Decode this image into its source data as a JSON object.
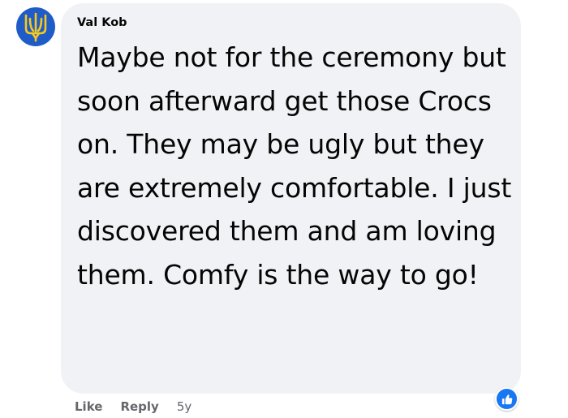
{
  "comment": {
    "author": "Val Kob",
    "text": "Maybe not for the ceremony but soon afterward get those Crocs on. They may be ugly but they are extremely comfortable. I just discovered them and am loving them. Comfy is the way to go!",
    "avatar_icon": "ukraine-trident-icon",
    "reaction_icon": "like-icon",
    "colors": {
      "avatar_bg": "#1f5cc7",
      "avatar_emblem": "#f6c91f",
      "bubble_bg": "#f0f2f5",
      "like_blue": "#1877f2",
      "muted_text": "#65676b"
    }
  },
  "actions": {
    "like_label": "Like",
    "reply_label": "Reply",
    "timestamp": "5y"
  }
}
